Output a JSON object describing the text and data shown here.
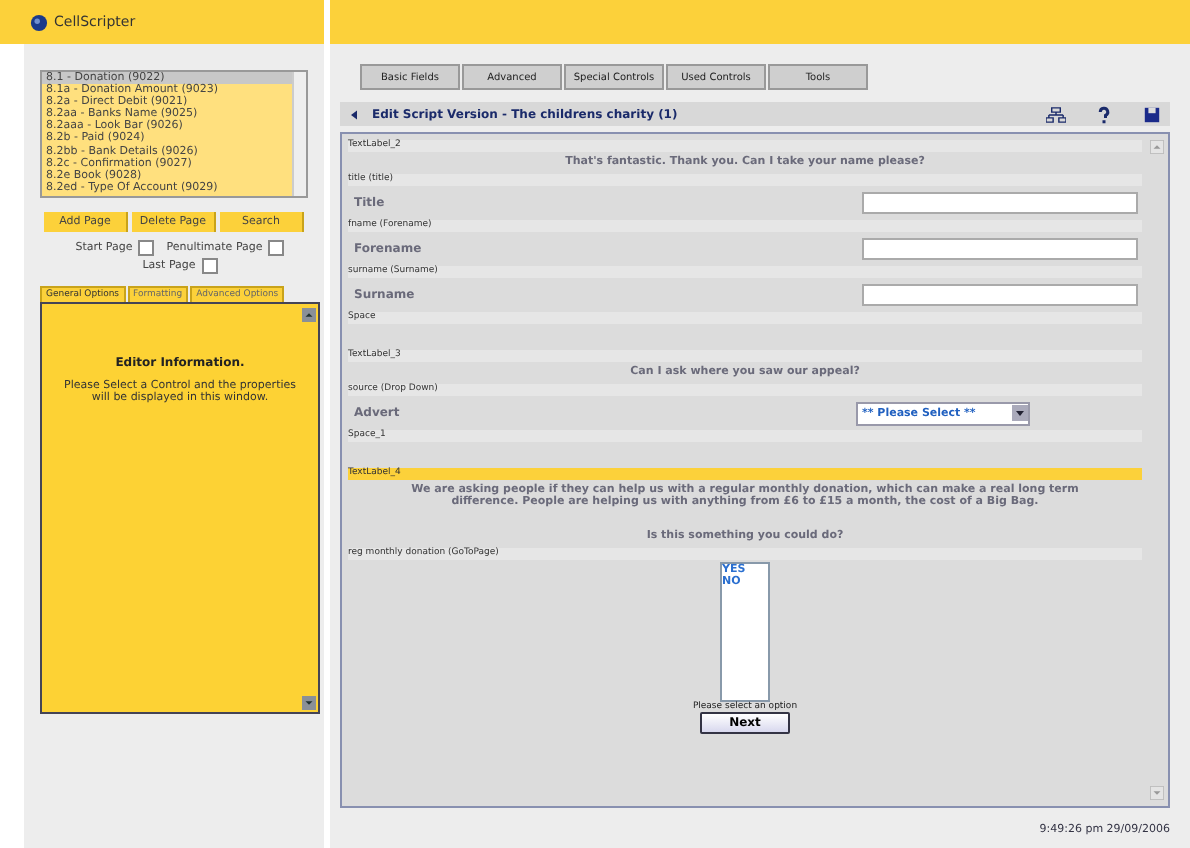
{
  "app": {
    "title": "CellScripter"
  },
  "pages": [
    {
      "label": "8.1 - Donation (9022)",
      "selected": true
    },
    {
      "label": "8.1a - Donation Amount (9023)",
      "selected": false
    },
    {
      "label": "8.2a - Direct Debit (9021)",
      "selected": false
    },
    {
      "label": "8.2aa - Banks Name (9025)",
      "selected": false
    },
    {
      "label": "8.2aaa - Look Bar (9026)",
      "selected": false
    },
    {
      "label": "8.2b - Paid (9024)",
      "selected": false
    },
    {
      "label": "8.2bb - Bank Details (9026)",
      "selected": false
    },
    {
      "label": "8.2c - Confirmation (9027)",
      "selected": false
    },
    {
      "label": "8.2e Book (9028)",
      "selected": false
    },
    {
      "label": "8.2ed - Type Of Account (9029)",
      "selected": false
    }
  ],
  "page_buttons": [
    "Add Page",
    "Delete Page",
    "Search"
  ],
  "page_flags": [
    {
      "label": "Start Page",
      "checked": false
    },
    {
      "label": "Penultimate Page",
      "checked": false
    },
    {
      "label": "Last Page",
      "checked": false
    }
  ],
  "option_tabs": [
    {
      "label": "General Options",
      "selected": true
    },
    {
      "label": "Formatting",
      "selected": false
    },
    {
      "label": "Advanced Options",
      "selected": false
    }
  ],
  "editor_info": {
    "heading": "Editor Information.",
    "text": "Please Select a Control and the properties will be displayed in this window."
  },
  "toolbar": [
    "Basic Fields",
    "Advanced",
    "Special Controls",
    "Used Controls",
    "Tools"
  ],
  "script_title": "Edit Script Version - The childrens charity (1)",
  "controls": [
    {
      "kind": "text",
      "label": "TextLabel_2",
      "selected": false,
      "text": "That's fantastic. Thank you. Can I take your name please?"
    },
    {
      "kind": "input",
      "label": "title (title)",
      "selected": false,
      "text": "Title"
    },
    {
      "kind": "input",
      "label": "fname (Forename)",
      "selected": false,
      "text": "Forename"
    },
    {
      "kind": "input",
      "label": "surname (Surname)",
      "selected": false,
      "text": "Surname"
    },
    {
      "kind": "space",
      "label": "Space",
      "selected": false
    },
    {
      "kind": "text",
      "label": "TextLabel_3",
      "selected": false,
      "text": "Can I ask where you saw our appeal?"
    },
    {
      "kind": "select",
      "label": "source (Drop Down)",
      "selected": false,
      "text": "Advert",
      "value": "** Please Select **"
    },
    {
      "kind": "space",
      "label": "Space_1",
      "selected": false
    },
    {
      "kind": "text",
      "label": "TextLabel_4",
      "selected": true,
      "text": "We are asking people if they can help us with a regular monthly donation, which can make a real long term difference. People are helping us with anything from £6 to £15 a month, the cost of a Big Bag.",
      "text2": "Is this something you could do?"
    },
    {
      "kind": "listbox",
      "label": "reg monthly donation (GoToPage)",
      "selected": false,
      "options": [
        "YES",
        "NO"
      ],
      "hint": "Please select an option",
      "button": "Next"
    }
  ],
  "status": "9:49:26 pm 29/09/2006"
}
